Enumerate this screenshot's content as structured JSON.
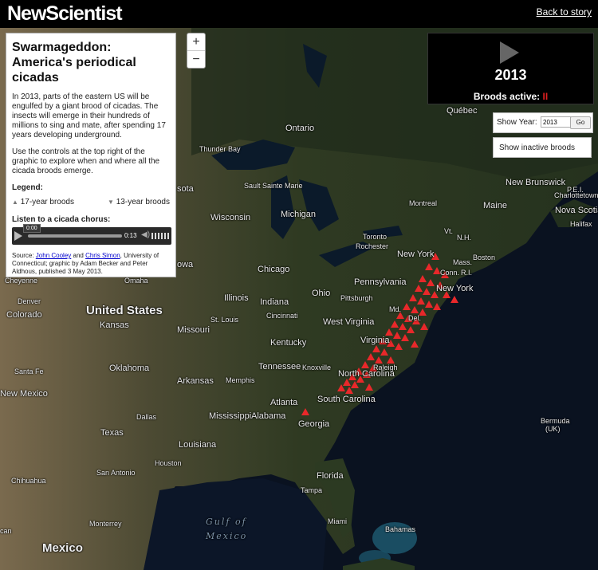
{
  "header": {
    "logo": "NewScientist",
    "back_link": "Back to story"
  },
  "info_panel": {
    "title": "Swarmageddon: America's periodical cicadas",
    "intro": "In 2013, parts of the eastern US will be engulfed by a giant brood of cicadas. The insects will emerge in their hundreds of millions to sing and mate, after spending 17 years developing underground.",
    "instructions": "Use the controls at the top right of the graphic to explore when and where all the cicada broods emerge.",
    "legend_title": "Legend:",
    "legend_17": "17-year broods",
    "legend_13": "13-year broods",
    "audio_title": "Listen to a cicada chorus:",
    "audio_current": "0:00",
    "audio_time": "0:13",
    "source_prefix": "Source: ",
    "source_author1": "John Cooley",
    "source_and": " and ",
    "source_author2": "Chris Simon",
    "source_suffix": ", University of Connecticut; graphic by Adam Becker and Peter Aldhous, published 3 May 2013."
  },
  "zoom": {
    "in": "+",
    "out": "−"
  },
  "player": {
    "year": "2013",
    "broods_label": "Broods active:",
    "broods_value": "II"
  },
  "year_control": {
    "label": "Show Year:",
    "value": "2013",
    "go": "Go"
  },
  "inactive_toggle": "Show inactive broods",
  "map_labels": {
    "ontario": "Ontario",
    "quebec": "Québec",
    "new_brunswick": "New Brunswick",
    "pei": "P.E.I.",
    "charlottetown": "Charlottetown",
    "nova_scotia": "Nova Scotia",
    "halifax": "Halifax",
    "maine": "Maine",
    "montreal": "Montreal",
    "vt": "Vt.",
    "nh": "N.H.",
    "mass": "Mass.",
    "boston": "Boston",
    "conn": "Conn.",
    "ri": "R.I.",
    "new_york_state": "New York",
    "new_york_city": "New York",
    "toronto": "Toronto",
    "rochester": "Rochester",
    "thunder_bay": "Thunder Bay",
    "sault": "Sault Sainte Marie",
    "michigan": "Michigan",
    "wisconsin": "Wisconsin",
    "chicago": "Chicago",
    "pennsylvania": "Pennsylvania",
    "pittsburgh": "Pittsburgh",
    "ohio": "Ohio",
    "indiana": "Indiana",
    "illinois": "Illinois",
    "cincinnati": "Cincinnati",
    "st_louis": "St. Louis",
    "missouri": "Missouri",
    "kansas": "Kansas",
    "united_states": "United States",
    "west_virginia": "West Virginia",
    "md": "Md.",
    "del": "Del.",
    "virginia": "Virginia",
    "kentucky": "Kentucky",
    "tennessee": "Tennessee",
    "knoxville": "Knoxville",
    "raleigh": "Raleigh",
    "north_carolina": "North Carolina",
    "south_carolina": "South Carolina",
    "atlanta": "Atlanta",
    "georgia": "Georgia",
    "alabama": "Alabama",
    "mississippi": "Mississippi",
    "arkansas": "Arkansas",
    "memphis": "Memphis",
    "oklahoma": "Oklahoma",
    "dallas": "Dallas",
    "texas": "Texas",
    "louisiana": "Louisiana",
    "houston": "Houston",
    "san_antonio": "San Antonio",
    "florida": "Florida",
    "tampa": "Tampa",
    "miami": "Miami",
    "bahamas": "Bahamas",
    "gulf": "Gulf of",
    "mexico_water": "Mexico",
    "mexico_country": "Mexico",
    "monterrey": "Monterrey",
    "chihuahua": "Chihuahua",
    "new_mexico": "New Mexico",
    "santa_fe": "Santa Fe",
    "denver": "Denver",
    "colorado": "Colorado",
    "cheyenne": "Cheyenne",
    "omaha": "Omaha",
    "iowa": "owa",
    "sota": "sota",
    "bermuda": "Bermuda",
    "uk": "(UK)",
    "can": "can"
  },
  "colors": {
    "brood_marker": "#e8282a",
    "background": "#000000",
    "active_brood": "#e02020"
  }
}
